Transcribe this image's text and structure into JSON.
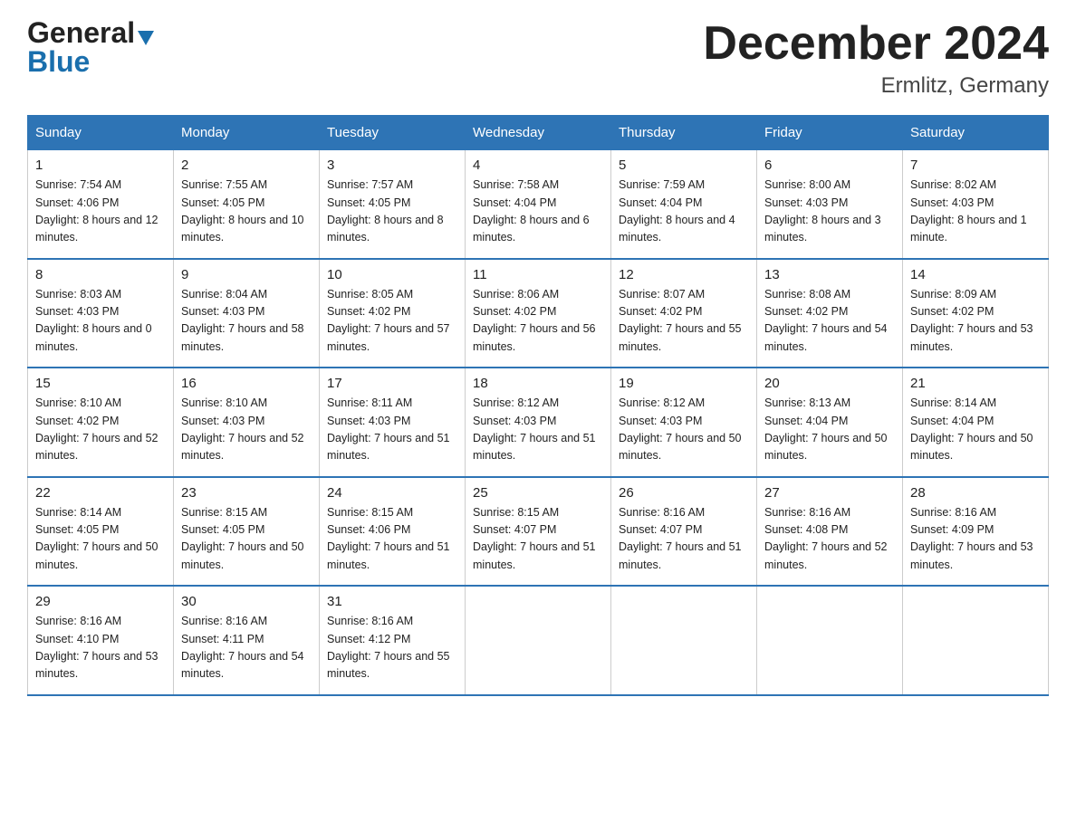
{
  "header": {
    "logo_general": "General",
    "logo_blue": "Blue",
    "title": "December 2024",
    "subtitle": "Ermlitz, Germany"
  },
  "weekdays": [
    "Sunday",
    "Monday",
    "Tuesday",
    "Wednesday",
    "Thursday",
    "Friday",
    "Saturday"
  ],
  "weeks": [
    [
      {
        "day": "1",
        "sunrise": "7:54 AM",
        "sunset": "4:06 PM",
        "daylight": "8 hours and 12 minutes."
      },
      {
        "day": "2",
        "sunrise": "7:55 AM",
        "sunset": "4:05 PM",
        "daylight": "8 hours and 10 minutes."
      },
      {
        "day": "3",
        "sunrise": "7:57 AM",
        "sunset": "4:05 PM",
        "daylight": "8 hours and 8 minutes."
      },
      {
        "day": "4",
        "sunrise": "7:58 AM",
        "sunset": "4:04 PM",
        "daylight": "8 hours and 6 minutes."
      },
      {
        "day": "5",
        "sunrise": "7:59 AM",
        "sunset": "4:04 PM",
        "daylight": "8 hours and 4 minutes."
      },
      {
        "day": "6",
        "sunrise": "8:00 AM",
        "sunset": "4:03 PM",
        "daylight": "8 hours and 3 minutes."
      },
      {
        "day": "7",
        "sunrise": "8:02 AM",
        "sunset": "4:03 PM",
        "daylight": "8 hours and 1 minute."
      }
    ],
    [
      {
        "day": "8",
        "sunrise": "8:03 AM",
        "sunset": "4:03 PM",
        "daylight": "8 hours and 0 minutes."
      },
      {
        "day": "9",
        "sunrise": "8:04 AM",
        "sunset": "4:03 PM",
        "daylight": "7 hours and 58 minutes."
      },
      {
        "day": "10",
        "sunrise": "8:05 AM",
        "sunset": "4:02 PM",
        "daylight": "7 hours and 57 minutes."
      },
      {
        "day": "11",
        "sunrise": "8:06 AM",
        "sunset": "4:02 PM",
        "daylight": "7 hours and 56 minutes."
      },
      {
        "day": "12",
        "sunrise": "8:07 AM",
        "sunset": "4:02 PM",
        "daylight": "7 hours and 55 minutes."
      },
      {
        "day": "13",
        "sunrise": "8:08 AM",
        "sunset": "4:02 PM",
        "daylight": "7 hours and 54 minutes."
      },
      {
        "day": "14",
        "sunrise": "8:09 AM",
        "sunset": "4:02 PM",
        "daylight": "7 hours and 53 minutes."
      }
    ],
    [
      {
        "day": "15",
        "sunrise": "8:10 AM",
        "sunset": "4:02 PM",
        "daylight": "7 hours and 52 minutes."
      },
      {
        "day": "16",
        "sunrise": "8:10 AM",
        "sunset": "4:03 PM",
        "daylight": "7 hours and 52 minutes."
      },
      {
        "day": "17",
        "sunrise": "8:11 AM",
        "sunset": "4:03 PM",
        "daylight": "7 hours and 51 minutes."
      },
      {
        "day": "18",
        "sunrise": "8:12 AM",
        "sunset": "4:03 PM",
        "daylight": "7 hours and 51 minutes."
      },
      {
        "day": "19",
        "sunrise": "8:12 AM",
        "sunset": "4:03 PM",
        "daylight": "7 hours and 50 minutes."
      },
      {
        "day": "20",
        "sunrise": "8:13 AM",
        "sunset": "4:04 PM",
        "daylight": "7 hours and 50 minutes."
      },
      {
        "day": "21",
        "sunrise": "8:14 AM",
        "sunset": "4:04 PM",
        "daylight": "7 hours and 50 minutes."
      }
    ],
    [
      {
        "day": "22",
        "sunrise": "8:14 AM",
        "sunset": "4:05 PM",
        "daylight": "7 hours and 50 minutes."
      },
      {
        "day": "23",
        "sunrise": "8:15 AM",
        "sunset": "4:05 PM",
        "daylight": "7 hours and 50 minutes."
      },
      {
        "day": "24",
        "sunrise": "8:15 AM",
        "sunset": "4:06 PM",
        "daylight": "7 hours and 51 minutes."
      },
      {
        "day": "25",
        "sunrise": "8:15 AM",
        "sunset": "4:07 PM",
        "daylight": "7 hours and 51 minutes."
      },
      {
        "day": "26",
        "sunrise": "8:16 AM",
        "sunset": "4:07 PM",
        "daylight": "7 hours and 51 minutes."
      },
      {
        "day": "27",
        "sunrise": "8:16 AM",
        "sunset": "4:08 PM",
        "daylight": "7 hours and 52 minutes."
      },
      {
        "day": "28",
        "sunrise": "8:16 AM",
        "sunset": "4:09 PM",
        "daylight": "7 hours and 53 minutes."
      }
    ],
    [
      {
        "day": "29",
        "sunrise": "8:16 AM",
        "sunset": "4:10 PM",
        "daylight": "7 hours and 53 minutes."
      },
      {
        "day": "30",
        "sunrise": "8:16 AM",
        "sunset": "4:11 PM",
        "daylight": "7 hours and 54 minutes."
      },
      {
        "day": "31",
        "sunrise": "8:16 AM",
        "sunset": "4:12 PM",
        "daylight": "7 hours and 55 minutes."
      },
      null,
      null,
      null,
      null
    ]
  ]
}
